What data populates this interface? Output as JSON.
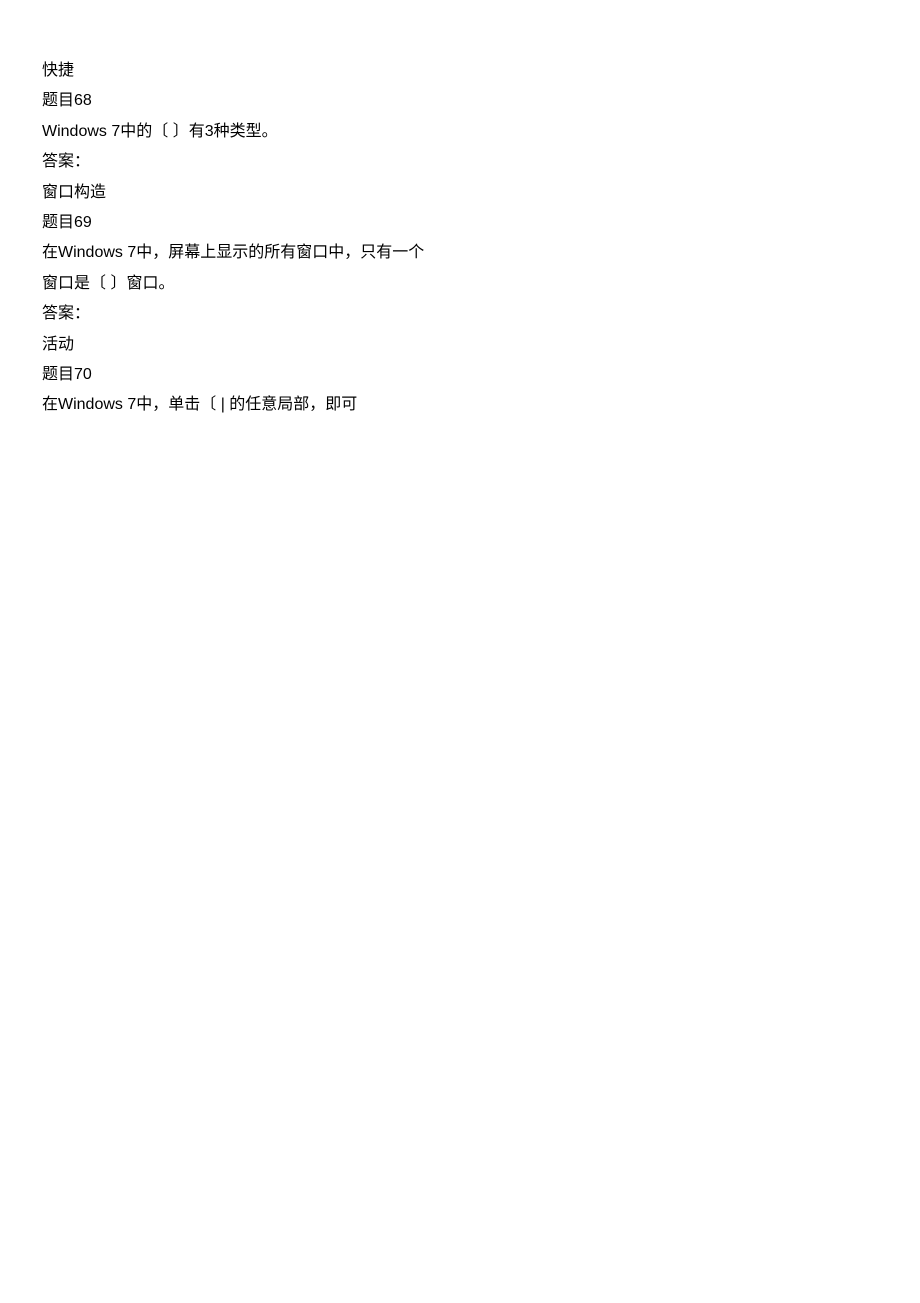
{
  "lines": [
    "快捷",
    "题目68",
    "Windows 7中的〔               〕有3种类型。",
    "答案：",
    "窗口构造",
    "题目69",
    "在Windows 7中，屏幕上显示的所有窗口中，只有一个",
    "窗口是〔               〕窗口。",
    "答案：",
    "活动",
    "题目70",
    "在Windows 7中，单击〔               | 的任意局部，即可"
  ]
}
